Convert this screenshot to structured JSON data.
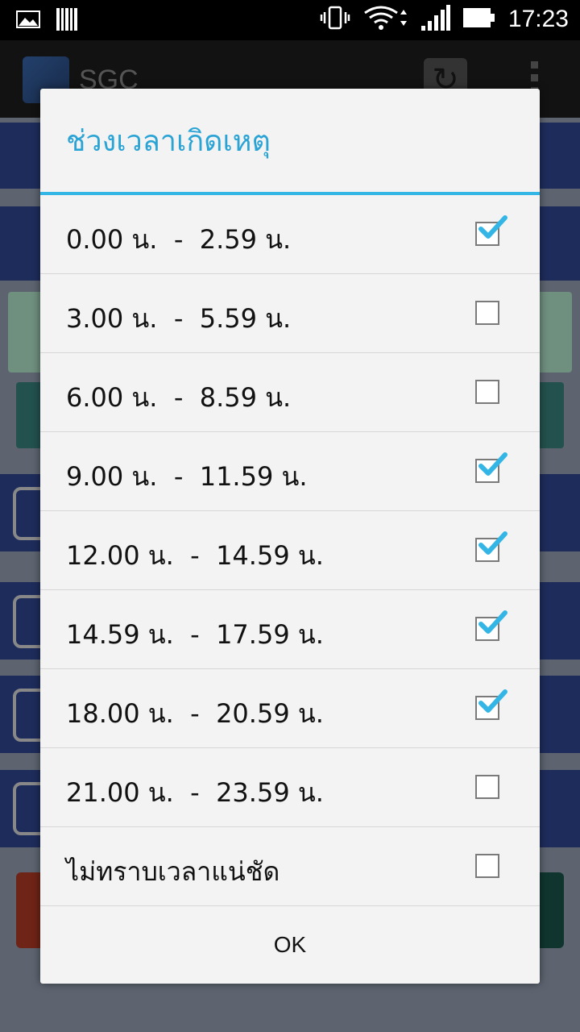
{
  "status_bar": {
    "time": "17:23",
    "icons": [
      "gallery-icon",
      "barcode-icon",
      "vibrate-icon",
      "wifi-icon",
      "signal-icon",
      "battery-icon"
    ]
  },
  "app_bar": {
    "title": "SGC",
    "icons": [
      "app-logo-icon",
      "refresh-icon",
      "overflow-menu-icon"
    ]
  },
  "dialog": {
    "title": "ช่วงเวลาเกิดเหตุ",
    "accent_color": "#33b5e5",
    "items": [
      {
        "label": "0.00 น.  -  2.59 น.",
        "checked": true
      },
      {
        "label": "3.00 น.  -  5.59 น.",
        "checked": false
      },
      {
        "label": "6.00 น.  -  8.59 น.",
        "checked": false
      },
      {
        "label": "9.00 น.  -  11.59 น.",
        "checked": true
      },
      {
        "label": "12.00 น.  -  14.59 น.",
        "checked": true
      },
      {
        "label": "14.59 น.  -  17.59 น.",
        "checked": true
      },
      {
        "label": "18.00 น.  -  20.59 น.",
        "checked": true
      },
      {
        "label": "21.00 น.  -  23.59 น.",
        "checked": false
      },
      {
        "label": "ไม่ทราบเวลาแน่ชัด",
        "checked": false
      }
    ],
    "ok_label": "OK"
  }
}
